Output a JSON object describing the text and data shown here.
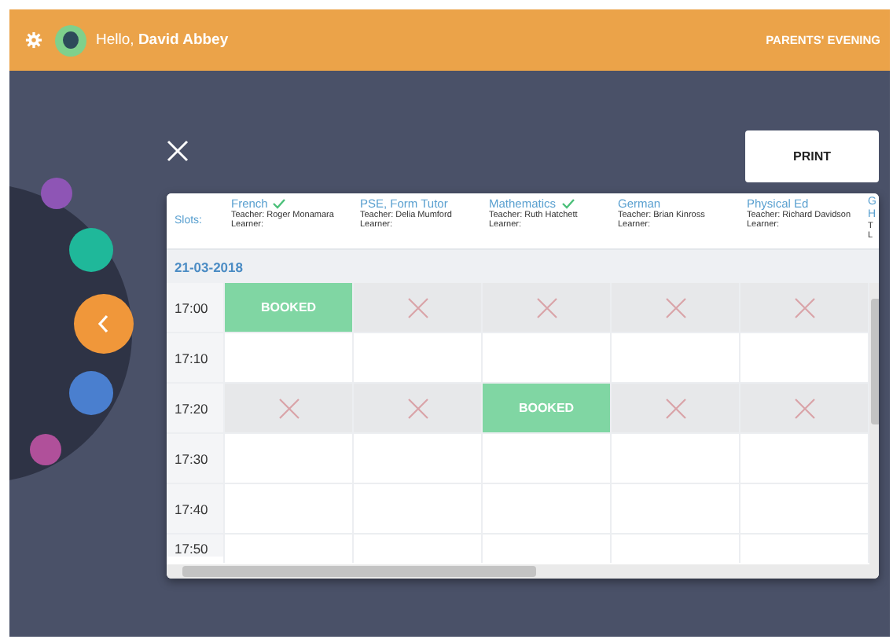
{
  "header": {
    "greeting": "Hello,",
    "user_name": "David Abbey",
    "section": "PARENTS' EVENING"
  },
  "print_button": "PRINT",
  "table": {
    "slots_label": "Slots:",
    "columns": [
      {
        "subject": "French",
        "confirmed": true,
        "teacher": "Teacher: Roger Monamara",
        "learner": "Learner:"
      },
      {
        "subject": "PSE, Form Tutor",
        "confirmed": false,
        "teacher": "Teacher: Delia Mumford",
        "learner": "Learner:"
      },
      {
        "subject": "Mathematics",
        "confirmed": true,
        "teacher": "Teacher: Ruth Hatchett",
        "learner": "Learner:"
      },
      {
        "subject": "German",
        "confirmed": false,
        "teacher": "Teacher: Brian Kinross",
        "learner": "Learner:"
      },
      {
        "subject": "Physical Ed",
        "confirmed": false,
        "teacher": "Teacher: Richard Davidson",
        "learner": "Learner:"
      }
    ],
    "cut_column": [
      "G",
      "H",
      "T",
      "L"
    ],
    "date": "21-03-2018",
    "rows": [
      {
        "time": "17:00",
        "cells": [
          {
            "kind": "booked",
            "text": "BOOKED"
          },
          {
            "kind": "unavailable"
          },
          {
            "kind": "unavailable"
          },
          {
            "kind": "unavailable"
          },
          {
            "kind": "unavailable"
          }
        ]
      },
      {
        "time": "17:10",
        "cells": [
          {
            "kind": "free"
          },
          {
            "kind": "free"
          },
          {
            "kind": "free"
          },
          {
            "kind": "free"
          },
          {
            "kind": "free"
          }
        ]
      },
      {
        "time": "17:20",
        "cells": [
          {
            "kind": "unavailable"
          },
          {
            "kind": "unavailable"
          },
          {
            "kind": "booked",
            "text": "BOOKED"
          },
          {
            "kind": "unavailable"
          },
          {
            "kind": "unavailable"
          }
        ]
      },
      {
        "time": "17:30",
        "cells": [
          {
            "kind": "free"
          },
          {
            "kind": "free"
          },
          {
            "kind": "free"
          },
          {
            "kind": "free"
          },
          {
            "kind": "free"
          }
        ]
      },
      {
        "time": "17:40",
        "cells": [
          {
            "kind": "free"
          },
          {
            "kind": "free"
          },
          {
            "kind": "free"
          },
          {
            "kind": "free"
          },
          {
            "kind": "free"
          }
        ]
      },
      {
        "time": "17:50",
        "cells": [
          {
            "kind": "free"
          },
          {
            "kind": "free"
          },
          {
            "kind": "free"
          },
          {
            "kind": "free"
          },
          {
            "kind": "free"
          }
        ]
      }
    ]
  },
  "wheel": [
    {
      "kind": "dot",
      "color": "#8e55b5"
    },
    {
      "kind": "dot",
      "color": "#1fb89a"
    },
    {
      "kind": "back"
    },
    {
      "kind": "dot",
      "color": "#4a7fcf"
    },
    {
      "kind": "dot",
      "color": "#b0509a"
    }
  ]
}
